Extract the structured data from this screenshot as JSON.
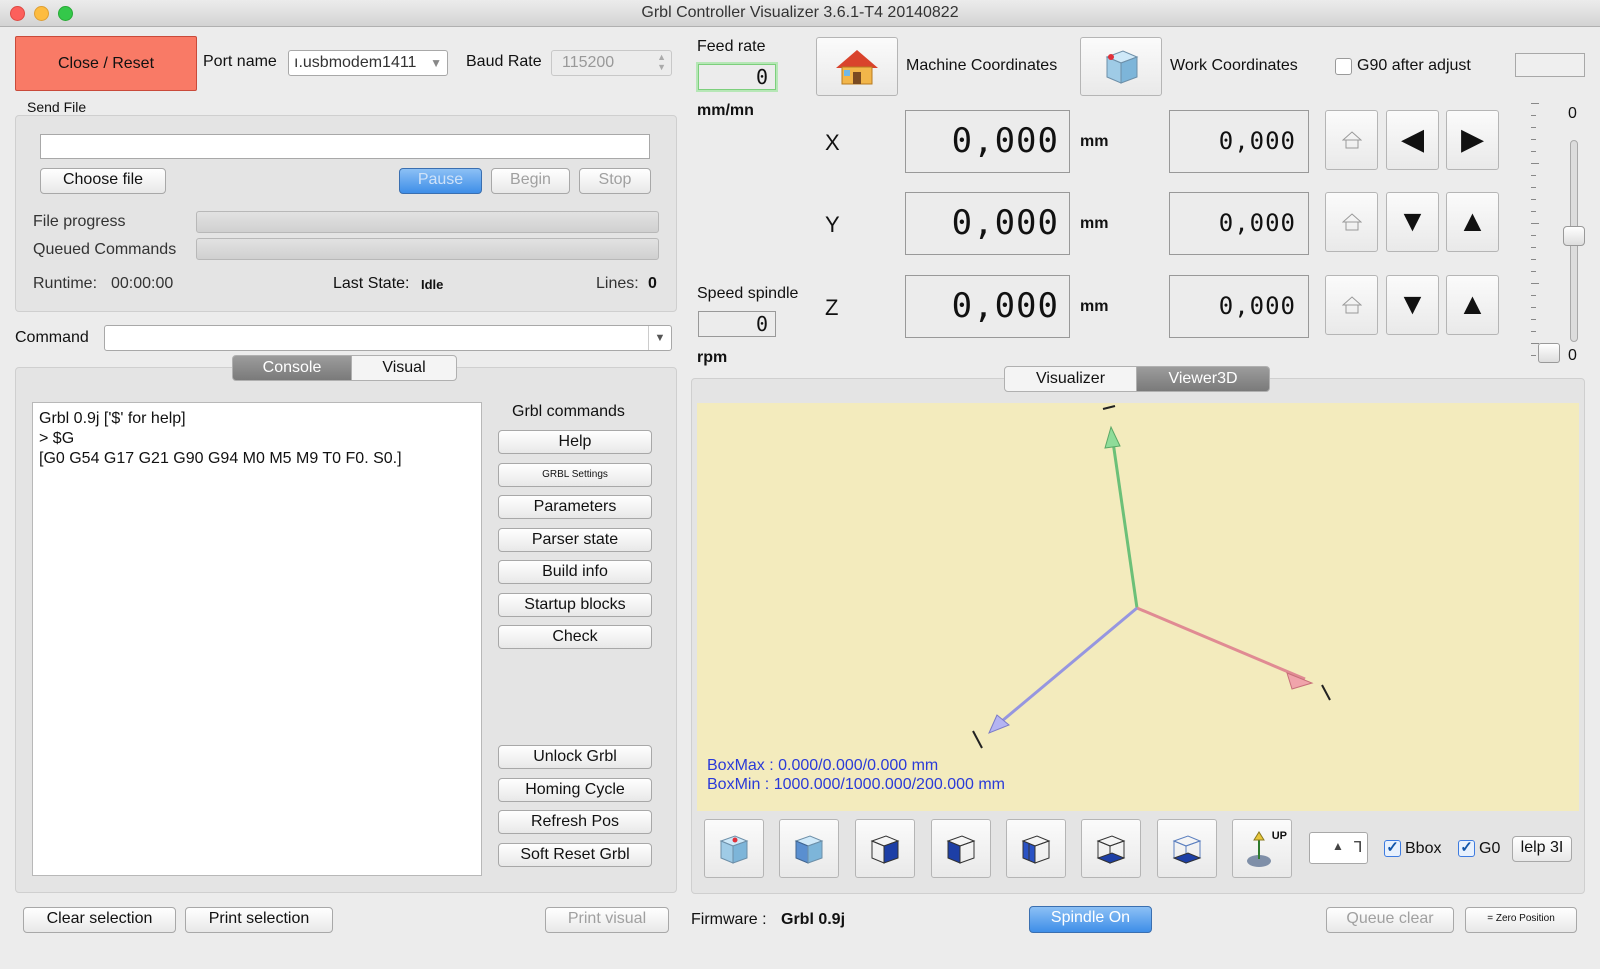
{
  "window": {
    "title": "Grbl Controller Visualizer 3.6.1-T4  20140822"
  },
  "connection": {
    "close_reset": "Close / Reset",
    "port_label": "Port name",
    "port_value": "ı.usbmodem1411",
    "baud_label": "Baud Rate",
    "baud_value": "115200"
  },
  "send_file": {
    "section_label": "Send File",
    "file_path": "",
    "choose_file": "Choose file",
    "pause": "Pause",
    "begin": "Begin",
    "stop": "Stop",
    "file_progress_label": "File progress",
    "file_progress": 0,
    "queued_label": "Queued Commands",
    "queued_progress": 0,
    "runtime_label": "Runtime:",
    "runtime_value": "00:00:00",
    "last_state_label": "Last State:",
    "last_state_value": "Idle",
    "lines_label": "Lines:",
    "lines_value": "0"
  },
  "command": {
    "label": "Command",
    "value": ""
  },
  "tabs_left": {
    "console": "Console",
    "visual": "Visual",
    "active": "Console"
  },
  "console_lines": [
    "Grbl 0.9j ['$' for help]",
    "> $G",
    "[G0 G54 G17 G21 G90 G94 M0 M5 M9 T0 F0. S0.]"
  ],
  "grbl_commands": {
    "title": "Grbl commands",
    "help": "Help",
    "grbl_settings": "GRBL Settings",
    "parameters": "Parameters",
    "parser_state": "Parser state",
    "build_info": "Build info",
    "startup_blocks": "Startup blocks",
    "check": "Check",
    "unlock": "Unlock Grbl",
    "homing": "Homing Cycle",
    "refresh": "Refresh Pos",
    "soft_reset": "Soft Reset Grbl"
  },
  "bottom_left": {
    "clear_selection": "Clear selection",
    "print_selection": "Print selection",
    "print_visual": "Print visual"
  },
  "feed": {
    "label": "Feed rate",
    "value": "0",
    "unit": "mm/mn"
  },
  "spindle": {
    "label": "Speed spindle",
    "value": "0",
    "unit": "rpm"
  },
  "coords": {
    "machine_label": "Machine Coordinates",
    "work_label": "Work Coordinates",
    "g90_label": "G90 after adjust",
    "g90_checked": false,
    "axes": [
      {
        "name": "X",
        "machine": "0,000",
        "unit": "mm",
        "work": "0,000"
      },
      {
        "name": "Y",
        "machine": "0,000",
        "unit": "mm",
        "work": "0,000"
      },
      {
        "name": "Z",
        "machine": "0,000",
        "unit": "mm",
        "work": "0,000"
      }
    ]
  },
  "slider": {
    "top_label": "0",
    "bottom_label": "0"
  },
  "tabs_right": {
    "visualizer": "Visualizer",
    "viewer3d": "Viewer3D",
    "active": "Viewer3D"
  },
  "viewer": {
    "box_max": "BoxMax : 0.000/0.000/0.000 mm",
    "box_min": "BoxMin : 1000.000/1000.000/200.000 mm",
    "background": "#f3ebbd",
    "axis_colors": {
      "x": "#e89aa0",
      "y": "#7fd08a",
      "z": "#a6a6ee"
    }
  },
  "viewer_controls": {
    "views": [
      "cube-iso-icon",
      "cube-front-icon",
      "cube-top-icon",
      "cube-left-icon",
      "cube-right-icon",
      "cube-bottom-icon",
      "cube-back-icon",
      "up-view-icon"
    ],
    "up_label": "UP",
    "bbox_label": "Bbox",
    "bbox_checked": true,
    "g0_label": "G0",
    "g0_checked": true,
    "help3d": "lelp 3I"
  },
  "status": {
    "firmware_label": "Firmware :",
    "firmware_value": "Grbl 0.9j",
    "spindle_on": "Spindle On",
    "queue_clear": "Queue clear",
    "zero_position": "= Zero Position"
  }
}
